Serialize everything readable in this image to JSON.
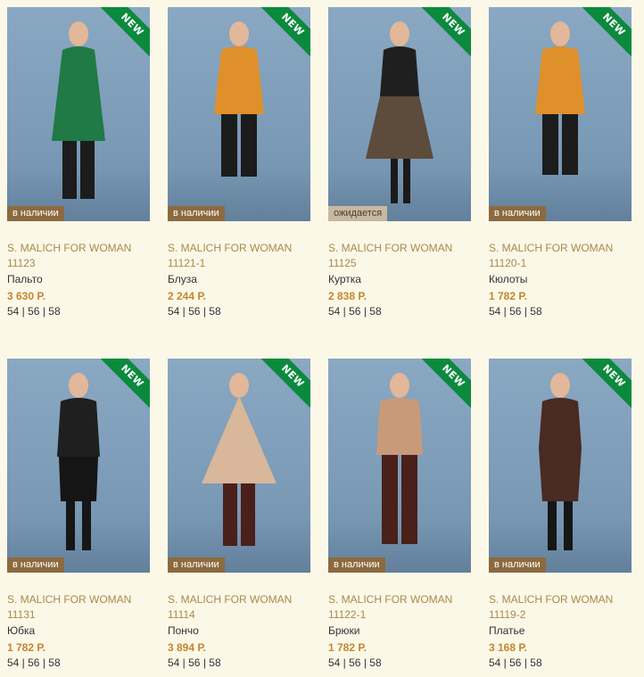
{
  "products": [
    {
      "badge": "NEW",
      "status": "в наличии",
      "status_kind": "in",
      "brand": "S. MALICH FOR WOMAN",
      "sku": "11123",
      "name": "Пальто",
      "price": "3 630 Р.",
      "sizes": "54 | 56 | 58",
      "top_color": "#1f7a45",
      "bottom_color": "#1c1c1c"
    },
    {
      "badge": "NEW",
      "status": "в наличии",
      "status_kind": "in",
      "brand": "S. MALICH FOR WOMAN",
      "sku": "11121-1",
      "name": "Блуза",
      "price": "2 244 Р.",
      "sizes": "54 | 56 | 58",
      "top_color": "#e0902a",
      "bottom_color": "#1c1c1c"
    },
    {
      "badge": "NEW",
      "status": "ожидается",
      "status_kind": "wait",
      "brand": "S. MALICH FOR WOMAN",
      "sku": "11125",
      "name": "Куртка",
      "price": "2 838 Р.",
      "sizes": "54 | 56 | 58",
      "top_color": "#1f1f1f",
      "bottom_color": "#5d4b3c"
    },
    {
      "badge": "NEW",
      "status": "в наличии",
      "status_kind": "in",
      "brand": "S. MALICH FOR WOMAN",
      "sku": "11120-1",
      "name": "Кюлоты",
      "price": "1 782 Р.",
      "sizes": "54 | 56 | 58",
      "top_color": "#e0902a",
      "bottom_color": "#1c1c1c"
    },
    {
      "badge": "NEW",
      "status": "в наличии",
      "status_kind": "in",
      "brand": "S. MALICH FOR WOMAN",
      "sku": "11131",
      "name": "Юбка",
      "price": "1 782 Р.",
      "sizes": "54 | 56 | 58",
      "top_color": "#1f1f1f",
      "bottom_color": "#151515"
    },
    {
      "badge": "NEW",
      "status": "в наличии",
      "status_kind": "in",
      "brand": "S. MALICH FOR WOMAN",
      "sku": "11114",
      "name": "Пончо",
      "price": "3 894 Р.",
      "sizes": "54 | 56 | 58",
      "top_color": "#d8b79a",
      "bottom_color": "#4b1f1a"
    },
    {
      "badge": "NEW",
      "status": "в наличии",
      "status_kind": "in",
      "brand": "S. MALICH FOR WOMAN",
      "sku": "11122-1",
      "name": "Брюки",
      "price": "1 782 Р.",
      "sizes": "54 | 56 | 58",
      "top_color": "#c99a7a",
      "bottom_color": "#4b1f1a"
    },
    {
      "badge": "NEW",
      "status": "в наличии",
      "status_kind": "in",
      "brand": "S. MALICH FOR WOMAN",
      "sku": "11119-2",
      "name": "Платье",
      "price": "3 168 Р.",
      "sizes": "54 | 56 | 58",
      "top_color": "#4a2a22",
      "bottom_color": "#4a2a22"
    }
  ]
}
